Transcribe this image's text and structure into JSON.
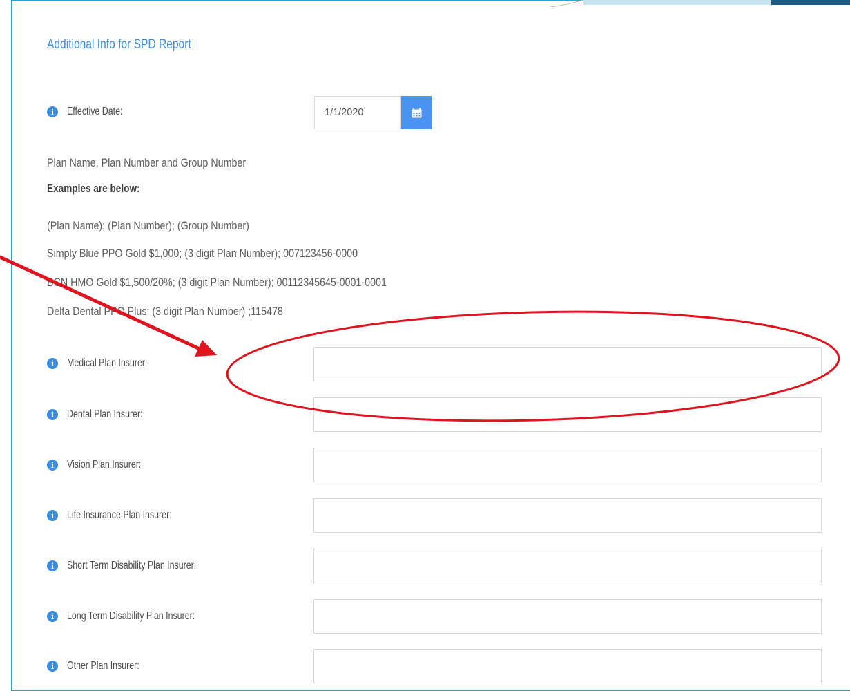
{
  "section": {
    "title": "Additional Info for SPD Report"
  },
  "effective_date": {
    "label": "Effective Date:",
    "value": "1/1/2020",
    "button_icon": "calendar-icon"
  },
  "plan_instructions": {
    "intro": "Plan Name, Plan Number and Group Number",
    "examples_heading": "Examples are below:",
    "format": "(Plan Name); (Plan Number); (Group Number)",
    "examples": [
      "Simply Blue PPO Gold $1,000; (3 digit Plan Number); 007123456-0000",
      "BCN HMO Gold $1,500/20%; (3 digit Plan Number); 00112345645-0001-0001",
      "Delta Dental PPO Plus; (3 digit Plan Number) ;115478"
    ]
  },
  "insurer_fields": [
    {
      "label": "Medical Plan Insurer:",
      "value": ""
    },
    {
      "label": "Dental Plan Insurer:",
      "value": ""
    },
    {
      "label": "Vision Plan Insurer:",
      "value": ""
    },
    {
      "label": "Life Insurance Plan Insurer:",
      "value": ""
    },
    {
      "label": "Short Term Disability Plan Insurer:",
      "value": ""
    },
    {
      "label": "Long Term Disability Plan Insurer:",
      "value": ""
    },
    {
      "label": "Other Plan Insurer:",
      "value": ""
    }
  ],
  "icons": {
    "info": "info-icon",
    "info_glyph": "i"
  },
  "colors": {
    "accent": "#3a8dde",
    "date_button": "#4b93f2",
    "frame_border": "#29a5dc",
    "annotation": "#e0141e"
  }
}
